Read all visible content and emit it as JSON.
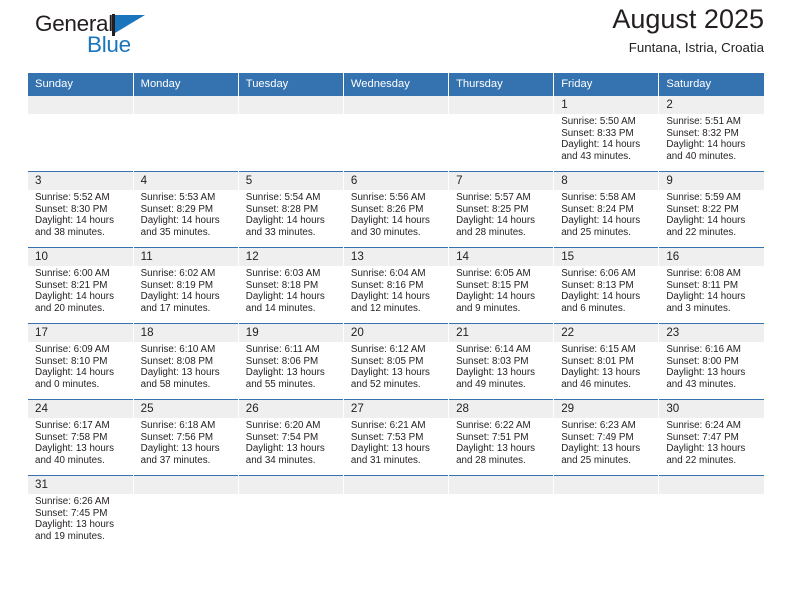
{
  "brand": {
    "name_top": "General",
    "name_bottom": "Blue",
    "accent_color": "#1b75bc"
  },
  "header": {
    "month_title": "August 2025",
    "location": "Funtana, Istria, Croatia"
  },
  "theme": {
    "header_bg": "#3572b0",
    "daynum_bg": "#efefef",
    "text_color": "#231f20"
  },
  "weekdays": [
    "Sunday",
    "Monday",
    "Tuesday",
    "Wednesday",
    "Thursday",
    "Friday",
    "Saturday"
  ],
  "weeks": [
    [
      {
        "day": "",
        "empty": true,
        "sunrise": "",
        "sunset": "",
        "daylight1": "",
        "daylight2": ""
      },
      {
        "day": "",
        "empty": true,
        "sunrise": "",
        "sunset": "",
        "daylight1": "",
        "daylight2": ""
      },
      {
        "day": "",
        "empty": true,
        "sunrise": "",
        "sunset": "",
        "daylight1": "",
        "daylight2": ""
      },
      {
        "day": "",
        "empty": true,
        "sunrise": "",
        "sunset": "",
        "daylight1": "",
        "daylight2": ""
      },
      {
        "day": "",
        "empty": true,
        "sunrise": "",
        "sunset": "",
        "daylight1": "",
        "daylight2": ""
      },
      {
        "day": "1",
        "empty": false,
        "sunrise": "Sunrise: 5:50 AM",
        "sunset": "Sunset: 8:33 PM",
        "daylight1": "Daylight: 14 hours",
        "daylight2": "and 43 minutes."
      },
      {
        "day": "2",
        "empty": false,
        "sunrise": "Sunrise: 5:51 AM",
        "sunset": "Sunset: 8:32 PM",
        "daylight1": "Daylight: 14 hours",
        "daylight2": "and 40 minutes."
      }
    ],
    [
      {
        "day": "3",
        "empty": false,
        "sunrise": "Sunrise: 5:52 AM",
        "sunset": "Sunset: 8:30 PM",
        "daylight1": "Daylight: 14 hours",
        "daylight2": "and 38 minutes."
      },
      {
        "day": "4",
        "empty": false,
        "sunrise": "Sunrise: 5:53 AM",
        "sunset": "Sunset: 8:29 PM",
        "daylight1": "Daylight: 14 hours",
        "daylight2": "and 35 minutes."
      },
      {
        "day": "5",
        "empty": false,
        "sunrise": "Sunrise: 5:54 AM",
        "sunset": "Sunset: 8:28 PM",
        "daylight1": "Daylight: 14 hours",
        "daylight2": "and 33 minutes."
      },
      {
        "day": "6",
        "empty": false,
        "sunrise": "Sunrise: 5:56 AM",
        "sunset": "Sunset: 8:26 PM",
        "daylight1": "Daylight: 14 hours",
        "daylight2": "and 30 minutes."
      },
      {
        "day": "7",
        "empty": false,
        "sunrise": "Sunrise: 5:57 AM",
        "sunset": "Sunset: 8:25 PM",
        "daylight1": "Daylight: 14 hours",
        "daylight2": "and 28 minutes."
      },
      {
        "day": "8",
        "empty": false,
        "sunrise": "Sunrise: 5:58 AM",
        "sunset": "Sunset: 8:24 PM",
        "daylight1": "Daylight: 14 hours",
        "daylight2": "and 25 minutes."
      },
      {
        "day": "9",
        "empty": false,
        "sunrise": "Sunrise: 5:59 AM",
        "sunset": "Sunset: 8:22 PM",
        "daylight1": "Daylight: 14 hours",
        "daylight2": "and 22 minutes."
      }
    ],
    [
      {
        "day": "10",
        "empty": false,
        "sunrise": "Sunrise: 6:00 AM",
        "sunset": "Sunset: 8:21 PM",
        "daylight1": "Daylight: 14 hours",
        "daylight2": "and 20 minutes."
      },
      {
        "day": "11",
        "empty": false,
        "sunrise": "Sunrise: 6:02 AM",
        "sunset": "Sunset: 8:19 PM",
        "daylight1": "Daylight: 14 hours",
        "daylight2": "and 17 minutes."
      },
      {
        "day": "12",
        "empty": false,
        "sunrise": "Sunrise: 6:03 AM",
        "sunset": "Sunset: 8:18 PM",
        "daylight1": "Daylight: 14 hours",
        "daylight2": "and 14 minutes."
      },
      {
        "day": "13",
        "empty": false,
        "sunrise": "Sunrise: 6:04 AM",
        "sunset": "Sunset: 8:16 PM",
        "daylight1": "Daylight: 14 hours",
        "daylight2": "and 12 minutes."
      },
      {
        "day": "14",
        "empty": false,
        "sunrise": "Sunrise: 6:05 AM",
        "sunset": "Sunset: 8:15 PM",
        "daylight1": "Daylight: 14 hours",
        "daylight2": "and 9 minutes."
      },
      {
        "day": "15",
        "empty": false,
        "sunrise": "Sunrise: 6:06 AM",
        "sunset": "Sunset: 8:13 PM",
        "daylight1": "Daylight: 14 hours",
        "daylight2": "and 6 minutes."
      },
      {
        "day": "16",
        "empty": false,
        "sunrise": "Sunrise: 6:08 AM",
        "sunset": "Sunset: 8:11 PM",
        "daylight1": "Daylight: 14 hours",
        "daylight2": "and 3 minutes."
      }
    ],
    [
      {
        "day": "17",
        "empty": false,
        "sunrise": "Sunrise: 6:09 AM",
        "sunset": "Sunset: 8:10 PM",
        "daylight1": "Daylight: 14 hours",
        "daylight2": "and 0 minutes."
      },
      {
        "day": "18",
        "empty": false,
        "sunrise": "Sunrise: 6:10 AM",
        "sunset": "Sunset: 8:08 PM",
        "daylight1": "Daylight: 13 hours",
        "daylight2": "and 58 minutes."
      },
      {
        "day": "19",
        "empty": false,
        "sunrise": "Sunrise: 6:11 AM",
        "sunset": "Sunset: 8:06 PM",
        "daylight1": "Daylight: 13 hours",
        "daylight2": "and 55 minutes."
      },
      {
        "day": "20",
        "empty": false,
        "sunrise": "Sunrise: 6:12 AM",
        "sunset": "Sunset: 8:05 PM",
        "daylight1": "Daylight: 13 hours",
        "daylight2": "and 52 minutes."
      },
      {
        "day": "21",
        "empty": false,
        "sunrise": "Sunrise: 6:14 AM",
        "sunset": "Sunset: 8:03 PM",
        "daylight1": "Daylight: 13 hours",
        "daylight2": "and 49 minutes."
      },
      {
        "day": "22",
        "empty": false,
        "sunrise": "Sunrise: 6:15 AM",
        "sunset": "Sunset: 8:01 PM",
        "daylight1": "Daylight: 13 hours",
        "daylight2": "and 46 minutes."
      },
      {
        "day": "23",
        "empty": false,
        "sunrise": "Sunrise: 6:16 AM",
        "sunset": "Sunset: 8:00 PM",
        "daylight1": "Daylight: 13 hours",
        "daylight2": "and 43 minutes."
      }
    ],
    [
      {
        "day": "24",
        "empty": false,
        "sunrise": "Sunrise: 6:17 AM",
        "sunset": "Sunset: 7:58 PM",
        "daylight1": "Daylight: 13 hours",
        "daylight2": "and 40 minutes."
      },
      {
        "day": "25",
        "empty": false,
        "sunrise": "Sunrise: 6:18 AM",
        "sunset": "Sunset: 7:56 PM",
        "daylight1": "Daylight: 13 hours",
        "daylight2": "and 37 minutes."
      },
      {
        "day": "26",
        "empty": false,
        "sunrise": "Sunrise: 6:20 AM",
        "sunset": "Sunset: 7:54 PM",
        "daylight1": "Daylight: 13 hours",
        "daylight2": "and 34 minutes."
      },
      {
        "day": "27",
        "empty": false,
        "sunrise": "Sunrise: 6:21 AM",
        "sunset": "Sunset: 7:53 PM",
        "daylight1": "Daylight: 13 hours",
        "daylight2": "and 31 minutes."
      },
      {
        "day": "28",
        "empty": false,
        "sunrise": "Sunrise: 6:22 AM",
        "sunset": "Sunset: 7:51 PM",
        "daylight1": "Daylight: 13 hours",
        "daylight2": "and 28 minutes."
      },
      {
        "day": "29",
        "empty": false,
        "sunrise": "Sunrise: 6:23 AM",
        "sunset": "Sunset: 7:49 PM",
        "daylight1": "Daylight: 13 hours",
        "daylight2": "and 25 minutes."
      },
      {
        "day": "30",
        "empty": false,
        "sunrise": "Sunrise: 6:24 AM",
        "sunset": "Sunset: 7:47 PM",
        "daylight1": "Daylight: 13 hours",
        "daylight2": "and 22 minutes."
      }
    ],
    [
      {
        "day": "31",
        "empty": false,
        "sunrise": "Sunrise: 6:26 AM",
        "sunset": "Sunset: 7:45 PM",
        "daylight1": "Daylight: 13 hours",
        "daylight2": "and 19 minutes."
      },
      {
        "day": "",
        "empty": true,
        "sunrise": "",
        "sunset": "",
        "daylight1": "",
        "daylight2": ""
      },
      {
        "day": "",
        "empty": true,
        "sunrise": "",
        "sunset": "",
        "daylight1": "",
        "daylight2": ""
      },
      {
        "day": "",
        "empty": true,
        "sunrise": "",
        "sunset": "",
        "daylight1": "",
        "daylight2": ""
      },
      {
        "day": "",
        "empty": true,
        "sunrise": "",
        "sunset": "",
        "daylight1": "",
        "daylight2": ""
      },
      {
        "day": "",
        "empty": true,
        "sunrise": "",
        "sunset": "",
        "daylight1": "",
        "daylight2": ""
      },
      {
        "day": "",
        "empty": true,
        "sunrise": "",
        "sunset": "",
        "daylight1": "",
        "daylight2": ""
      }
    ]
  ]
}
